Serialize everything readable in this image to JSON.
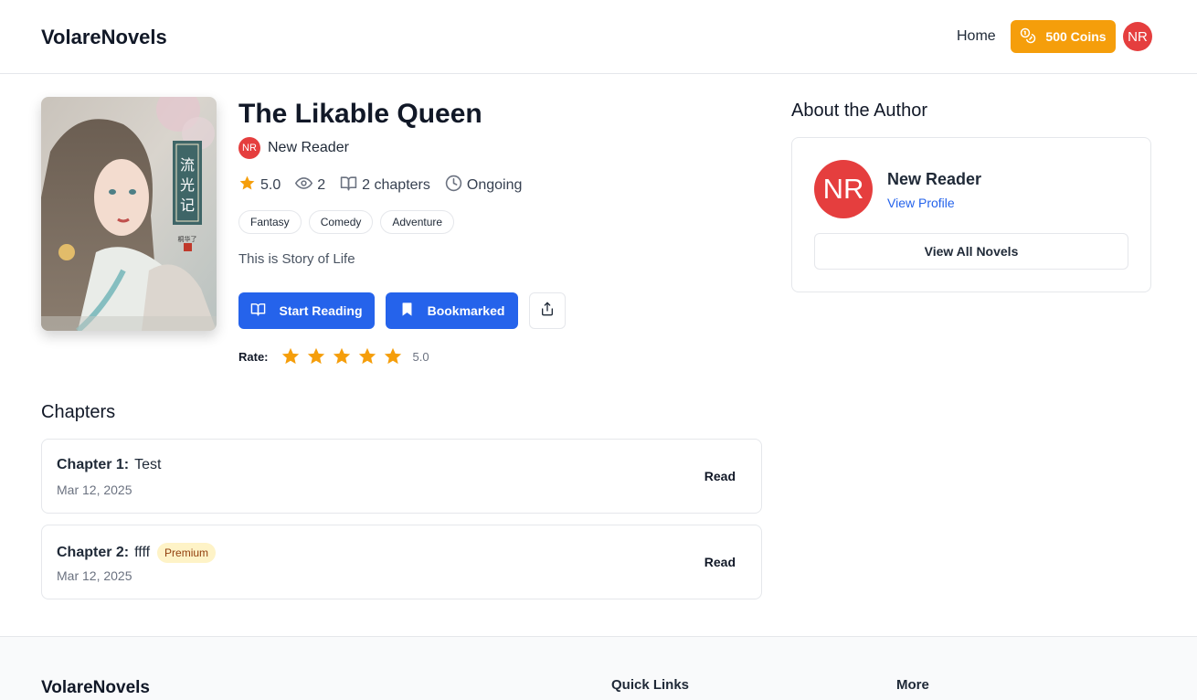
{
  "header": {
    "brand": "VolareNovels",
    "nav_home": "Home",
    "coins_label": "500 Coins",
    "user_initials": "NR"
  },
  "novel": {
    "title": "The Likable Queen",
    "author_initials": "NR",
    "author_name": "New Reader",
    "rating": "5.0",
    "views": "2",
    "chapters_count": "2 chapters",
    "status": "Ongoing",
    "tags": [
      "Fantasy",
      "Comedy",
      "Adventure"
    ],
    "description": "This is Story of Life",
    "start_reading_label": "Start Reading",
    "bookmarked_label": "Bookmarked",
    "rate_label": "Rate:",
    "rate_stars": 5,
    "rate_value": "5.0",
    "cover_calligraphy": "流光记",
    "cover_small_text": "桐华了"
  },
  "chapters": {
    "title": "Chapters",
    "items": [
      {
        "number": "Chapter 1:",
        "name": "Test",
        "date": "Mar 12, 2025",
        "premium": false,
        "action": "Read"
      },
      {
        "number": "Chapter 2:",
        "name": "ffff",
        "date": "Mar 12, 2025",
        "premium": true,
        "badge": "Premium",
        "action": "Read"
      }
    ]
  },
  "author_panel": {
    "title": "About the Author",
    "initials": "NR",
    "name": "New Reader",
    "view_profile": "View Profile",
    "view_all_novels": "View All Novels"
  },
  "footer": {
    "brand": "VolareNovels",
    "quick_links_title": "Quick Links",
    "more_title": "More"
  },
  "colors": {
    "accent": "#2563eb",
    "coins": "#f59e0b",
    "avatar": "#e53e3e",
    "star": "#f59e0b",
    "premium_bg": "#fef3c7"
  }
}
